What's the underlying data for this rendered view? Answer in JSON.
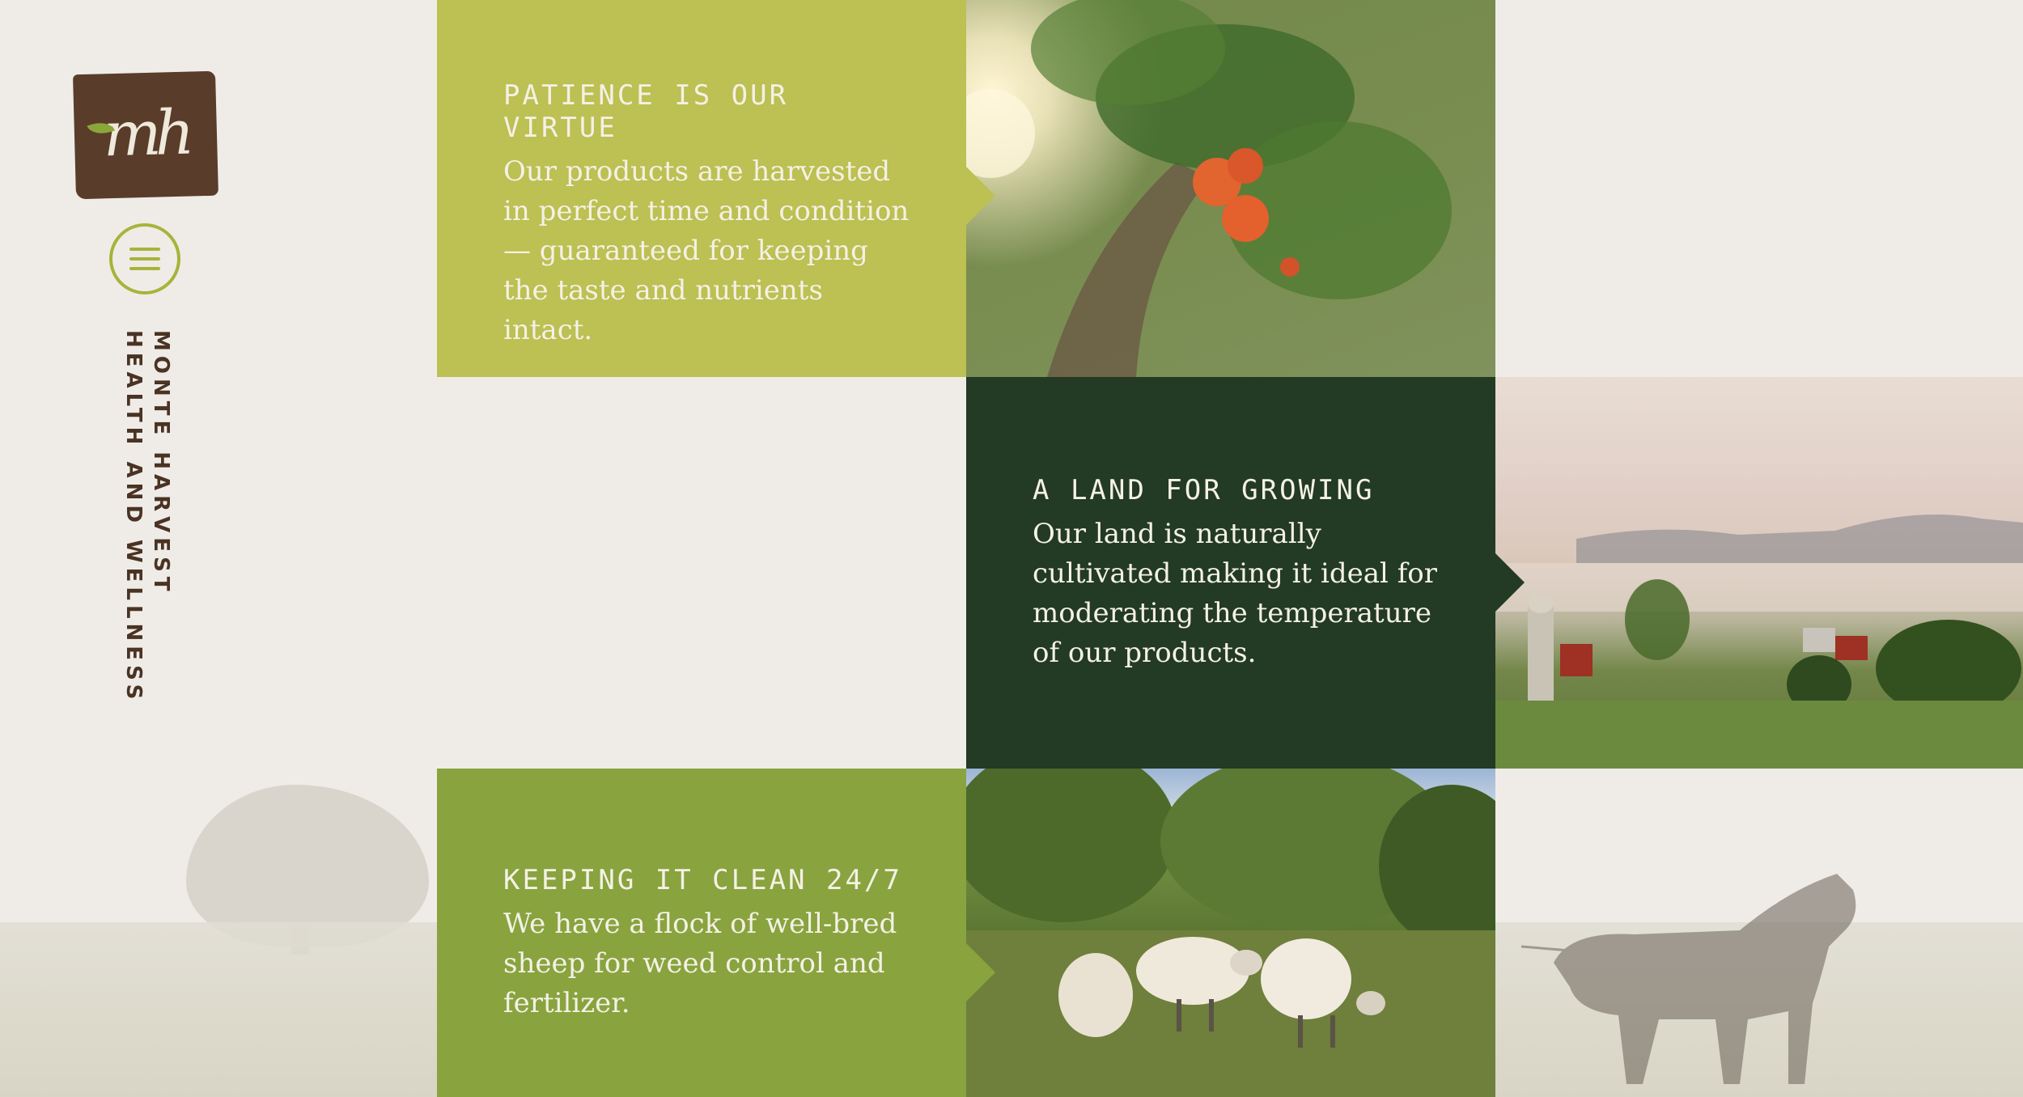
{
  "brand": {
    "logo_text": "mh",
    "tagline_line1": "MONTE HARVEST",
    "tagline_line2": "HEALTH AND WELLNESS"
  },
  "colors": {
    "block1": "#bdc052",
    "block2": "#233a24",
    "block3": "#89a33e",
    "logo": "#5a3c2a",
    "menu": "#a7b43a"
  },
  "sections": [
    {
      "title": "PATIENCE IS OUR VIRTUE",
      "body": "Our products are harvested in perfect time and condition — guaranteed for keeping the taste and nutrients intact.",
      "image": "apricot-tree-photo"
    },
    {
      "title": "A LAND FOR GROWING",
      "body": "Our land is naturally cultivated making it ideal for moderating the temperature of our products.",
      "image": "misty-farm-valley-photo"
    },
    {
      "title": "KEEPING IT CLEAN 24/7",
      "body": "We have a flock of well-bred sheep for weed control and fertilizer.",
      "image": "grazing-sheep-photo"
    }
  ],
  "icons": {
    "menu": "hamburger-menu-icon"
  }
}
